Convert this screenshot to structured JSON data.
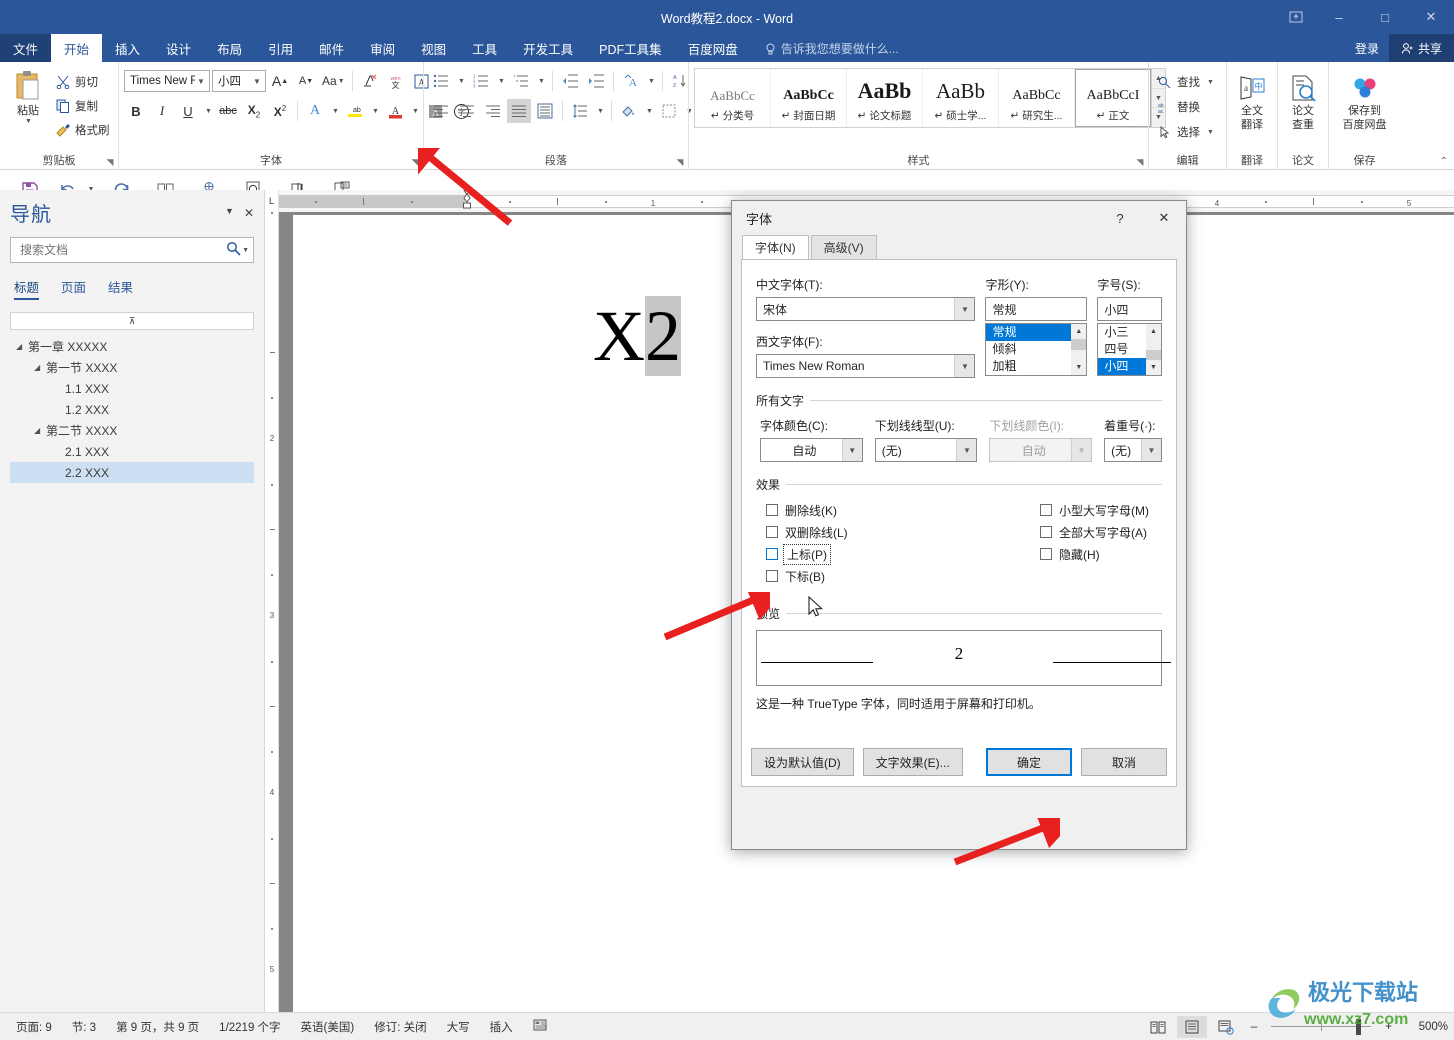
{
  "window": {
    "title": "Word教程2.docx - Word",
    "ribbon_display_icon": "ribbon-display-options-icon",
    "minimize": "–",
    "maximize": "□",
    "close": "✕"
  },
  "tabs": {
    "items": [
      {
        "label": "文件",
        "active": false,
        "file": true
      },
      {
        "label": "开始",
        "active": true
      },
      {
        "label": "插入",
        "active": false
      },
      {
        "label": "设计",
        "active": false
      },
      {
        "label": "布局",
        "active": false
      },
      {
        "label": "引用",
        "active": false
      },
      {
        "label": "邮件",
        "active": false
      },
      {
        "label": "审阅",
        "active": false
      },
      {
        "label": "视图",
        "active": false
      },
      {
        "label": "工具",
        "active": false
      },
      {
        "label": "开发工具",
        "active": false
      },
      {
        "label": "PDF工具集",
        "active": false
      },
      {
        "label": "百度网盘",
        "active": false
      }
    ],
    "tell_me": "告诉我您想要做什么...",
    "sign_in": "登录",
    "share": "共享"
  },
  "ribbon": {
    "clipboard": {
      "group_label": "剪贴板",
      "paste": "粘贴",
      "cut": "剪切",
      "copy": "复制",
      "format_painter": "格式刷"
    },
    "font": {
      "group_label": "字体",
      "font_name": "Times New F",
      "font_size": "小四",
      "grow_font": "A",
      "shrink_font": "A",
      "change_case": "Aa",
      "clear_format": "clear-formatting-icon",
      "phonetic": "wén 文",
      "char_border": "A",
      "bold": "B",
      "italic": "I",
      "underline": "U",
      "strikethrough": "abc",
      "subscript": "X₂",
      "superscript": "X²",
      "text_effects": "A",
      "highlight": "ab",
      "font_color": "A",
      "shading_char": "A",
      "enclose_char": "字"
    },
    "paragraph": {
      "group_label": "段落"
    },
    "styles": {
      "group_label": "样式",
      "items": [
        {
          "preview": "AaBbCc",
          "name": "分类号",
          "selected": false
        },
        {
          "preview": "AaBbCc",
          "name": "封面日期",
          "selected": false
        },
        {
          "preview": "AaBb",
          "name": "论文标题",
          "selected": false
        },
        {
          "preview": "AaBb",
          "name": "硕士学...",
          "selected": false
        },
        {
          "preview": "AaBbCc",
          "name": "研究生...",
          "selected": false
        },
        {
          "preview": "AaBbCcI",
          "name": "正文",
          "selected": true
        }
      ]
    },
    "editing": {
      "group_label": "编辑",
      "find": "查找",
      "replace": "替换",
      "select": "选择"
    },
    "translate": {
      "group_label": "翻译",
      "button_l1": "全文",
      "button_l2": "翻译"
    },
    "thesis": {
      "group_label": "论文",
      "button_l1": "论文",
      "button_l2": "查重"
    },
    "save": {
      "group_label": "保存",
      "button_l1": "保存到",
      "button_l2": "百度网盘"
    }
  },
  "navigation": {
    "title": "导航",
    "search_placeholder": "搜索文档",
    "search_value": "",
    "tabs": [
      {
        "label": "标题",
        "active": true
      },
      {
        "label": "页面",
        "active": false
      },
      {
        "label": "结果",
        "active": false
      }
    ],
    "items": [
      {
        "label": "第一章 XXXXX",
        "level": 0,
        "expandable": true,
        "selected": false
      },
      {
        "label": "第一节 XXXX",
        "level": 1,
        "expandable": true,
        "selected": false
      },
      {
        "label": "1.1 XXX",
        "level": 2,
        "expandable": false,
        "selected": false
      },
      {
        "label": "1.2 XXX",
        "level": 2,
        "expandable": false,
        "selected": false
      },
      {
        "label": "第二节 XXXX",
        "level": 1,
        "expandable": true,
        "selected": false
      },
      {
        "label": "2.1 XXX",
        "level": 2,
        "expandable": false,
        "selected": false
      },
      {
        "label": "2.2 XXX",
        "level": 2,
        "expandable": false,
        "selected": true
      }
    ]
  },
  "document": {
    "text_base": "X",
    "text_selected": "2",
    "ruler_ticks_h": [
      "1",
      "4",
      "5"
    ],
    "ruler_ticks_v": [
      "2",
      "3",
      "4",
      "5"
    ]
  },
  "dialog": {
    "title": "字体",
    "help": "?",
    "close": "✕",
    "tabs": [
      {
        "label": "字体(N)",
        "active": true
      },
      {
        "label": "高级(V)",
        "active": false
      }
    ],
    "cn_font_label": "中文字体(T):",
    "cn_font_value": "宋体",
    "latin_font_label": "西文字体(F):",
    "latin_font_value": "Times New Roman",
    "style_label": "字形(Y):",
    "style_value": "常规",
    "style_options": [
      "常规",
      "倾斜",
      "加粗"
    ],
    "style_selected_index": 0,
    "size_label": "字号(S):",
    "size_value": "小四",
    "size_options": [
      "小三",
      "四号",
      "小四"
    ],
    "size_selected_index": 2,
    "all_text_group": "所有文字",
    "font_color_label": "字体颜色(C):",
    "font_color_value": "自动",
    "underline_style_label": "下划线线型(U):",
    "underline_style_value": "(无)",
    "underline_color_label": "下划线颜色(I):",
    "underline_color_value": "自动",
    "emphasis_label": "着重号(·):",
    "emphasis_value": "(无)",
    "effects_group": "效果",
    "effects": [
      {
        "label": "删除线(K)",
        "checked": false,
        "focused": false
      },
      {
        "label": "双删除线(L)",
        "checked": false,
        "focused": false
      },
      {
        "label": "上标(P)",
        "checked": false,
        "focused": true
      },
      {
        "label": "下标(B)",
        "checked": false,
        "focused": false
      }
    ],
    "effects_right": [
      {
        "label": "小型大写字母(M)",
        "checked": false
      },
      {
        "label": "全部大写字母(A)",
        "checked": false
      },
      {
        "label": "隐藏(H)",
        "checked": false
      }
    ],
    "preview_group": "预览",
    "preview_text": "2",
    "preview_note": "这是一种 TrueType 字体，同时适用于屏幕和打印机。",
    "set_default": "设为默认值(D)",
    "text_effects": "文字效果(E)...",
    "ok": "确定",
    "cancel": "取消"
  },
  "status": {
    "page_of": "页面: 9",
    "section": "节: 3",
    "page_count": "第 9 页，共 9 页",
    "words": "1/2219 个字",
    "language": "英语(美国)",
    "track_changes": "修订: 关闭",
    "caps": "大写",
    "insert": "插入",
    "view_read": "read-mode-icon",
    "view_print": "print-layout-icon",
    "view_web": "web-layout-icon",
    "zoom_out": "–",
    "zoom_in": "+",
    "zoom_value": "500%"
  },
  "watermark": {
    "text": "极光下载站",
    "url": "www.xz7.com"
  },
  "colors": {
    "accent": "#2b579a",
    "selection": "#0078d7",
    "nav_selection": "#cddff2",
    "arrow": "#e8201f"
  }
}
